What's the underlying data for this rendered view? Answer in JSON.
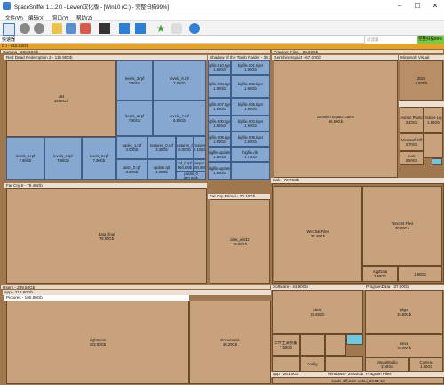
{
  "window": {
    "title": "SpaceSniffer 1.1.2.0 - Lewen汉化版 - [Win10 (C:) - 完整扫描99%]"
  },
  "menu": [
    "文件(W)",
    "编辑(X)",
    "窗口(Y)",
    "帮助(Z)"
  ],
  "address": {
    "label": "快速器",
    "filter_placeholder": "过滤器",
    "scan_status": "完整扫描99%"
  },
  "tree": {
    "root": "C:\\ - 815.02Gb",
    "gaming": "Gaming - 255.50Gb",
    "program_files": "Program Files - 88.60Gb",
    "users": "Users - 239.50Gb",
    "app": "app - 218.60Gb",
    "pictures": "Pictures - 100.80Gb",
    "rdr2": "Red Dead Redemption 2 - 116.90Gb",
    "tomb": "Shadow of the Tomb Raider - 38.30",
    "genshin": "Genshin Impact - 67.00Gb",
    "microsoft_visual": "Microsoft Visual",
    "farcry6": "Far Cry 6 - 79.40Gb",
    "farcry_primal": "Far Cry Primal - 20.10Gb",
    "task": "task - 72.70Gb",
    "wechat_label": "WeChat Files",
    "tencent_label": "Tencent Files",
    "software": "Software - 44.90Gb",
    "program_data": "ProgramData - 37.00Gb",
    "app2": "app - 26.10Gb",
    "windows": "Windows - 24.50Gb",
    "program_files_x86": "Program Files"
  },
  "cells": {
    "x64": "x64\n39.80Gb",
    "levels2": "levels_2.rpf\n7.90Gb",
    "levels4": "levels_4.rpf\n7.90Gb",
    "levels5": "levels_5.rpf\n7.90Gb",
    "levels6": "levels_6.rpf\n7.90Gb",
    "levels3": "levels_3.rpf\n7.90Gb",
    "levels1": "levels_1.rpf\n7.90Gb",
    "levels7": "levels_7.rpf\n6.50Gb",
    "packs1": "packs_1.rpf\n4.00Gb",
    "textures": "textures_0.rpf\n3.30Gb",
    "anim": "anim_0.rpf\n3.60Gb",
    "update": "update.rpf\n3.20Gb",
    "textures_dx11": "textures_0\n3.00Gb",
    "movies": "movies\n2.10Gb",
    "hd": "hd_0.rpf\n960.8Mb",
    "rowpack": "rowpack\n960.0Mb",
    "packs": "packs_0\n970.8Mb",
    "bigfile010": "bigfile.010.tiger\n1.90Gb",
    "bigfile001": "bigfile.001.tiger\n1.90Gb",
    "bigfile004": "bigfile.004.tiger\n1.90Gb",
    "bigfile002": "bigfile.002.tiger\n1.90Gb",
    "bigfile007": "bigfile.007.tiger\n1.90Gb",
    "bigfile005": "bigfile.005.tiger\n1.90Gb",
    "bigfile000": "bigfile.000.tiger\n1.90Gb",
    "bigfile003": "bigfile.003.tiger\n1.90Gb",
    "bigfile006": "bigfile.006.tiger\n1.90Gb",
    "bigfile008": "bigfile.008.tiger\n1.90Gb",
    "bigfile_upd": "bigfile.update\n1.90Gb",
    "bigfile_dlc": "bigfile.dlc\n1.70Gb",
    "bigfile_upd2": "bigfile.update\n1.80Gb",
    "genshin_game": "Genshin Impact Game\n66.60Gb",
    "vs2022": "2022\n6.60Gb",
    "adobe": "Adobe - 6.10Gb",
    "adobe_photo": "Adobe Photo\n3.40Gb",
    "adobe_lig": "Adobe Lig\n1.90Gb",
    "ms_office": "Microsoft Off\n3.70Gb",
    "root_cell": "root\n3.60Gb",
    "data_final": "data_final\n78.50Gb",
    "data_win32": "data_win32\n19.00Gb",
    "wechat": "WeChat Files\n37.40Gb",
    "tencent": "Tencent Files\n30.00Gb",
    "appdata": "AppData\n2.90Gb",
    "usrapp": "1.90Gb",
    "lightroom": "Lightroom\n202.80Gb",
    "documents": "Documents\n48.20Gb",
    "client": "client\n28.60Gb",
    "pkgs": "pkgs\n19.60Gb",
    "envs": "envs\n10.00Gb",
    "ctf": "CTF工具合集\n7.50Gb",
    "visual_studio": "VisualStudio\n3.50Gb",
    "camera": "Camera\n1.40Gb",
    "config": "config",
    "stable_diff": "stable-diffusion-webui_23-04-18"
  },
  "colors": {
    "file": "#c8a27c",
    "selected": "#86a8d0",
    "drive": "#e8a220",
    "scan_ok": "#7ac943"
  }
}
